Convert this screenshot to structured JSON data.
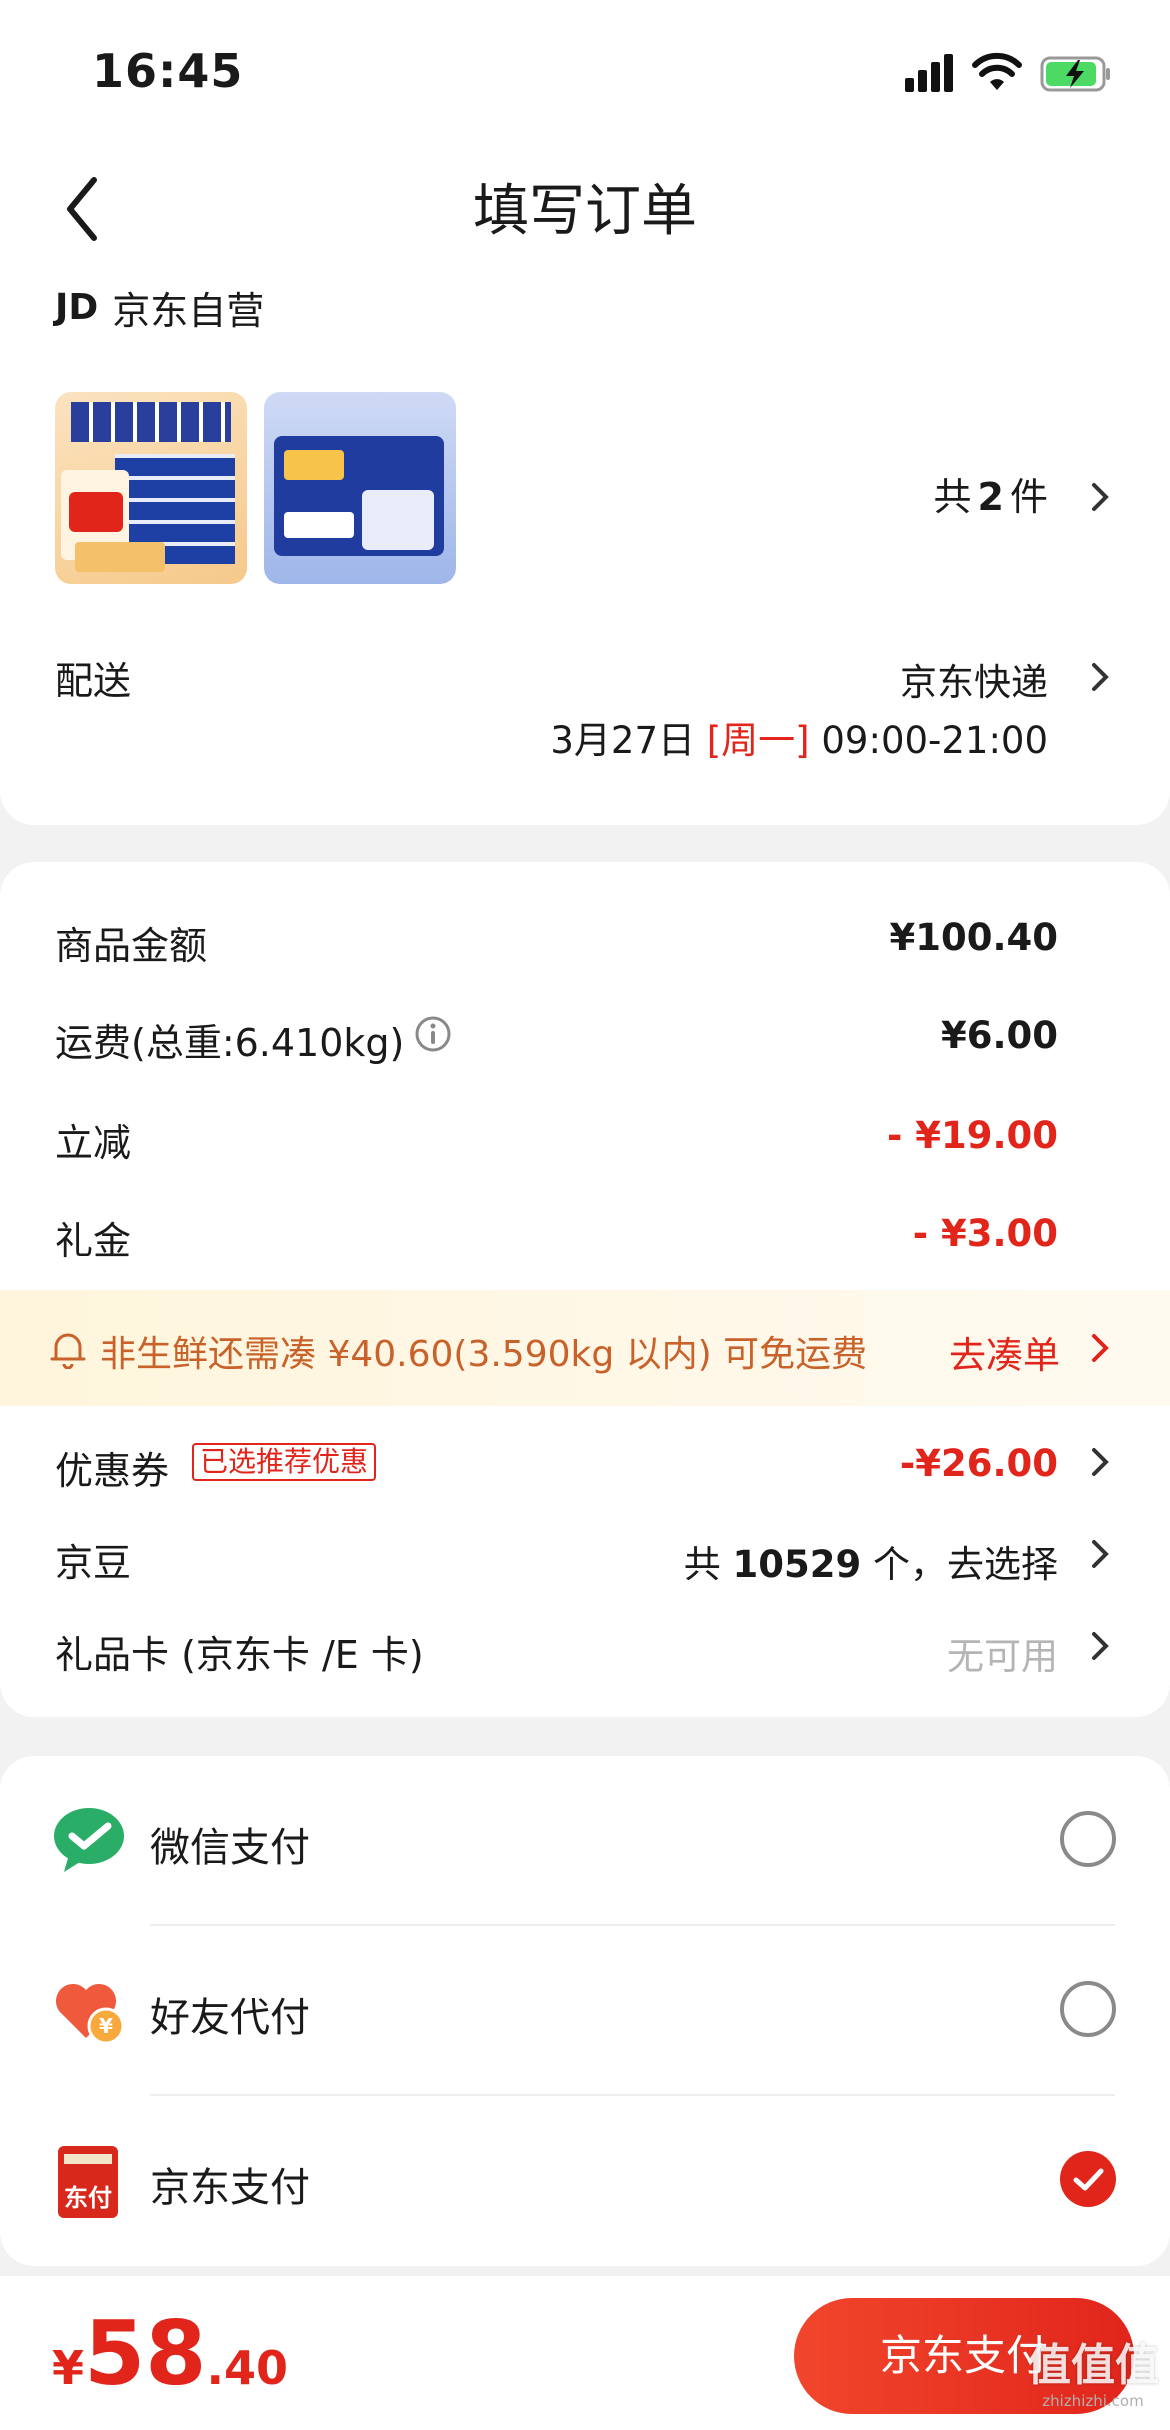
{
  "status_bar": {
    "time": "16:45"
  },
  "header": {
    "title": "填写订单"
  },
  "store": {
    "logo": "JD",
    "name": "京东自营"
  },
  "products": {
    "count_label_prefix": "共",
    "count": "2",
    "count_label_suffix": "件"
  },
  "delivery": {
    "label": "配送",
    "method": "京东快递",
    "date": "3月27日",
    "weekday": "[周一]",
    "time_window": "09:00-21:00"
  },
  "summary": {
    "goods_amount_label": "商品金额",
    "goods_amount": "¥100.40",
    "shipping_label": "运费(总重:6.410kg)",
    "shipping": "¥6.00",
    "instant_discount_label": "立减",
    "instant_discount": "- ¥19.00",
    "gift_money_label": "礼金",
    "gift_money": "- ¥3.00"
  },
  "free_shipping_banner": {
    "text": "非生鲜还需凑 ¥40.60(3.590kg 以内) 可免运费",
    "action": "去凑单"
  },
  "coupon": {
    "label": "优惠券",
    "badge": "已选推荐优惠",
    "value": "-¥26.00"
  },
  "jingdou": {
    "label": "京豆",
    "prefix": "共 ",
    "count": "10529",
    "suffix": " 个，去选择"
  },
  "gift_card": {
    "label": "礼品卡 (京东卡 /E 卡)",
    "value": "无可用"
  },
  "payment_methods": [
    {
      "label": "微信支付",
      "icon": "wechat-pay-icon",
      "selected": false
    },
    {
      "label": "好友代付",
      "icon": "friend-pay-icon",
      "selected": false
    },
    {
      "label": "京东支付",
      "icon": "jd-pay-icon",
      "icon_text": "东付",
      "selected": true
    }
  ],
  "bottom": {
    "currency": "¥",
    "price_int": "58",
    "price_dec": ".40",
    "pay_button": "京东支付"
  },
  "watermark": {
    "text": "值值值",
    "sub": "zhizhizhi.com"
  },
  "colors": {
    "accent": "#e1251b",
    "banner_bg": "#fff8e6",
    "banner_text": "#c8622a",
    "wechat": "#2aae67"
  }
}
